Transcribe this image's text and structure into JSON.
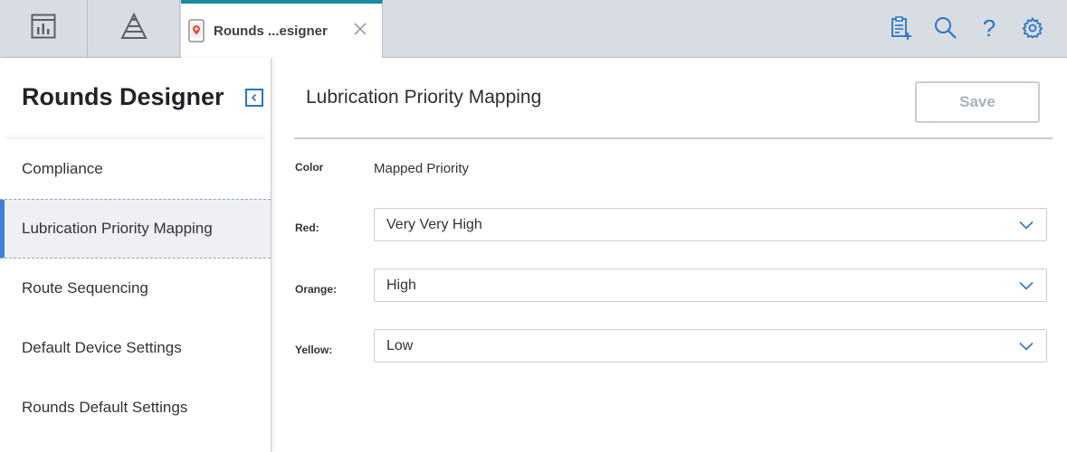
{
  "top_tabs": {
    "dashboard_tab_icon": "dashboard-icon",
    "hierarchy_tab_icon": "pyramid-icon",
    "active_tab": {
      "label": "Rounds ...esigner",
      "icon": "mobile-device-icon",
      "close_icon": "close-icon"
    }
  },
  "toolbar": {
    "icons": [
      "clipboard-add-icon",
      "search-icon",
      "help-icon",
      "gear-icon"
    ],
    "help_glyph": "?"
  },
  "sidebar": {
    "title": "Rounds Designer",
    "collapse_icon": "collapse-left-icon",
    "items": [
      {
        "label": "Compliance",
        "active": false
      },
      {
        "label": "Lubrication Priority Mapping",
        "active": true
      },
      {
        "label": "Route Sequencing",
        "active": false
      },
      {
        "label": "Default Device Settings",
        "active": false
      },
      {
        "label": "Rounds Default Settings",
        "active": false
      }
    ]
  },
  "main": {
    "title": "Lubrication Priority Mapping",
    "save_label": "Save",
    "columns": {
      "color": "Color",
      "mapped_priority": "Mapped Priority"
    },
    "rows": [
      {
        "label": "Red:",
        "value": "Very Very High"
      },
      {
        "label": "Orange:",
        "value": "High"
      },
      {
        "label": "Yellow:",
        "value": "Low"
      }
    ]
  },
  "colors": {
    "accent_blue": "#2c73c9",
    "active_tab_border": "#1a8aa0",
    "active_nav_marker": "#3d82d6",
    "topbar_bg": "#d8dde4"
  }
}
